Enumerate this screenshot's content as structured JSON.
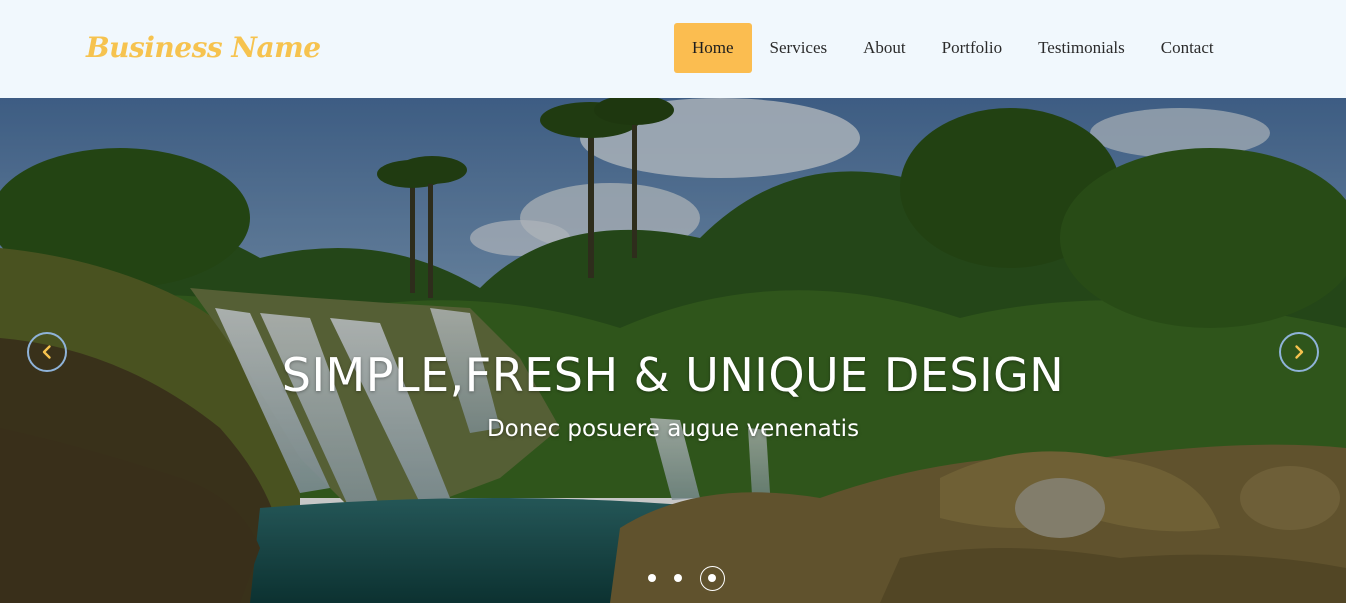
{
  "brand": {
    "name": "Business Name",
    "color": "#f6c34f"
  },
  "nav": {
    "items": [
      {
        "label": "Home",
        "active": true
      },
      {
        "label": "Services",
        "active": false
      },
      {
        "label": "About",
        "active": false
      },
      {
        "label": "Portfolio",
        "active": false
      },
      {
        "label": "Testimonials",
        "active": false
      },
      {
        "label": "Contact",
        "active": false
      }
    ],
    "active_color": "#fbbd50"
  },
  "hero": {
    "headline": "SIMPLE,FRESH & UNIQUE DESIGN",
    "subheadline": "Donec posuere augue venenatis",
    "background": "waterfall-landscape-photo",
    "prev_icon": "chevron-left-icon",
    "next_icon": "chevron-right-icon",
    "arrow_color": "#f6c34f",
    "slides_total": 3,
    "active_slide": 3
  }
}
